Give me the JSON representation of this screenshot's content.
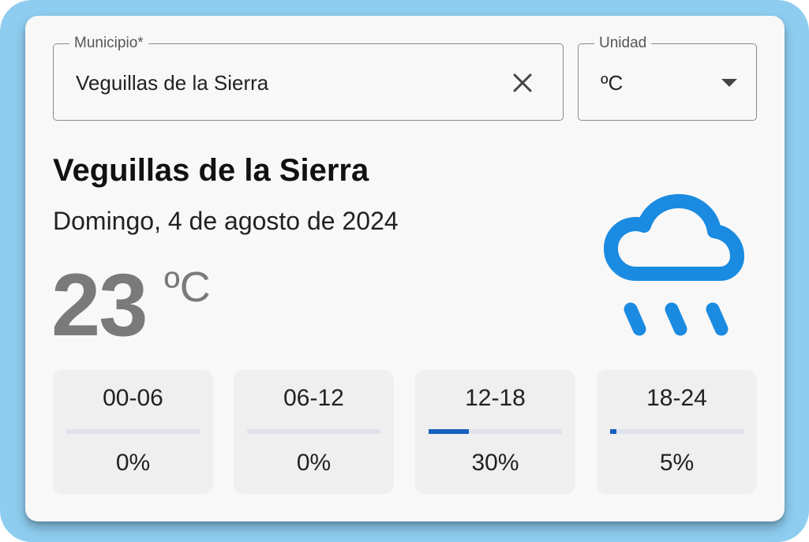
{
  "search": {
    "label": "Municipio*",
    "value": "Veguillas de la Sierra"
  },
  "unit_select": {
    "label": "Unidad",
    "value": "ºC"
  },
  "weather": {
    "city": "Veguillas de la Sierra",
    "date": "Domingo, 4 de agosto de 2024",
    "temperature": "23",
    "unit": "ºC",
    "icon": "rain-cloud-icon",
    "icon_color": "#1a8be0"
  },
  "colors": {
    "frame": "#8ecdf0",
    "card": "#f8f8f8",
    "bar_fill": "#1560bd",
    "bar_track": "#dfe2ec"
  },
  "precipitation": [
    {
      "label": "00-06",
      "value": "0%",
      "fraction": 0
    },
    {
      "label": "06-12",
      "value": "0%",
      "fraction": 0
    },
    {
      "label": "12-18",
      "value": "30%",
      "fraction": 0.3
    },
    {
      "label": "18-24",
      "value": "5%",
      "fraction": 0.05
    }
  ]
}
